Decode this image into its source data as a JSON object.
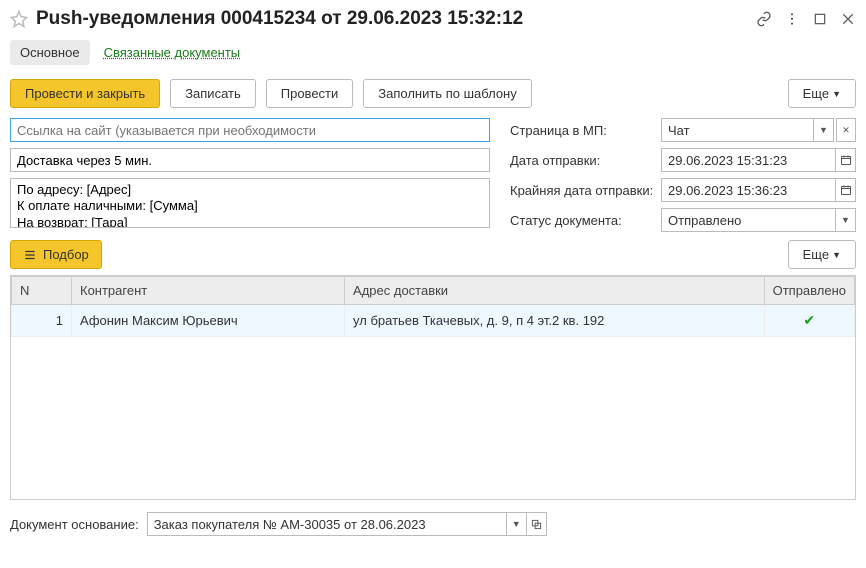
{
  "header": {
    "title": "Push-уведомления 000415234 от 29.06.2023 15:32:12"
  },
  "tabs": {
    "main": "Основное",
    "linked": "Связанные документы"
  },
  "toolbar": {
    "submit_close": "Провести и закрыть",
    "save": "Записать",
    "submit": "Провести",
    "fill_template": "Заполнить по шаблону",
    "more": "Еще"
  },
  "fields": {
    "url_placeholder": "Ссылка на сайт (указывается при необходимости",
    "delivery_value": "Доставка через 5 мин.",
    "template_text": "По адресу: [Адрес]\nК оплате наличными: [Сумма]\nНа возврат: [Тара]",
    "page_mp_label": "Страница в МП:",
    "page_mp_value": "Чат",
    "send_date_label": "Дата отправки:",
    "send_date_value": "29.06.2023 15:31:23",
    "deadline_label": "Крайняя дата отправки:",
    "deadline_value": "29.06.2023 15:36:23",
    "status_label": "Статус документа:",
    "status_value": "Отправлено"
  },
  "subtoolbar": {
    "pick": "Подбор",
    "more": "Еще"
  },
  "table": {
    "headers": {
      "n": "N",
      "contragent": "Контрагент",
      "address": "Адрес доставки",
      "sent": "Отправлено"
    },
    "rows": [
      {
        "n": "1",
        "contragent": "Афонин Максим Юрьевич",
        "address": "ул братьев Ткачевых,  д. 9,   п 4 эт.2 кв. 192",
        "sent": true
      }
    ]
  },
  "footer": {
    "basis_label": "Документ основание:",
    "basis_value": "Заказ покупателя № АМ-30035 от 28.06.2023"
  }
}
